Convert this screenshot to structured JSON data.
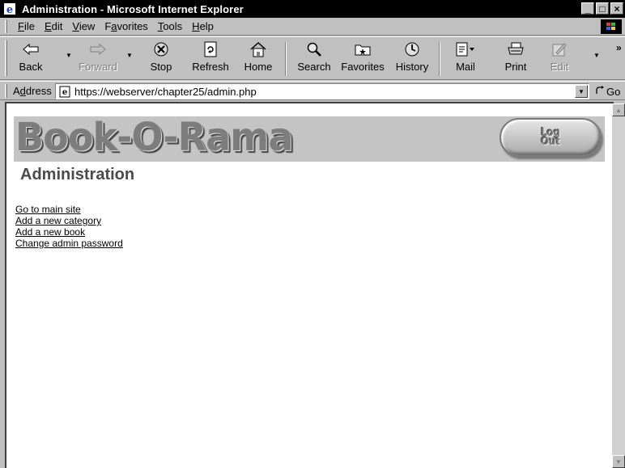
{
  "window": {
    "title": "Administration - Microsoft Internet Explorer",
    "controls": {
      "minimize": "_",
      "restore": "□",
      "close": "×"
    }
  },
  "menu": [
    {
      "label_ul": "F",
      "label_rest": "ile"
    },
    {
      "label_ul": "E",
      "label_rest": "dit"
    },
    {
      "label_ul": "V",
      "label_rest": "iew"
    },
    {
      "label_pre": "F",
      "label_ul": "a",
      "label_rest": "vorites"
    },
    {
      "label_ul": "T",
      "label_rest": "ools"
    },
    {
      "label_ul": "H",
      "label_rest": "elp"
    }
  ],
  "toolbar": {
    "back": {
      "label": "Back",
      "icon": "back-arrow-icon"
    },
    "forward": {
      "label": "Forward",
      "icon": "forward-arrow-icon",
      "enabled": false
    },
    "stop": {
      "label": "Stop",
      "icon": "stop-icon"
    },
    "refresh": {
      "label": "Refresh",
      "icon": "refresh-icon"
    },
    "home": {
      "label": "Home",
      "icon": "home-icon"
    },
    "search": {
      "label": "Search",
      "icon": "search-icon"
    },
    "favorites": {
      "label": "Favorites",
      "icon": "favorites-icon"
    },
    "history": {
      "label": "History",
      "icon": "history-icon"
    },
    "mail": {
      "label": "Mail",
      "icon": "mail-icon"
    },
    "print": {
      "label": "Print",
      "icon": "print-icon"
    },
    "edit": {
      "label": "Edit",
      "icon": "edit-icon",
      "enabled": false
    },
    "more": "»"
  },
  "address": {
    "label_pre": "A",
    "label_ul": "d",
    "label_rest": "dress",
    "url": "https://webserver/chapter25/admin.php",
    "go_label": "Go"
  },
  "page": {
    "brand": "Book-O-Rama",
    "logout_line1": "Log",
    "logout_line2": "Out",
    "heading": "Administration",
    "links": [
      "Go to main site",
      "Add a new category",
      "Add a new book",
      "Change admin password"
    ]
  },
  "colors": {
    "titlebar": "#000000",
    "chrome": "#c0c0c0",
    "banner": "#c4c4c4",
    "heading": "#4a4a4a"
  }
}
